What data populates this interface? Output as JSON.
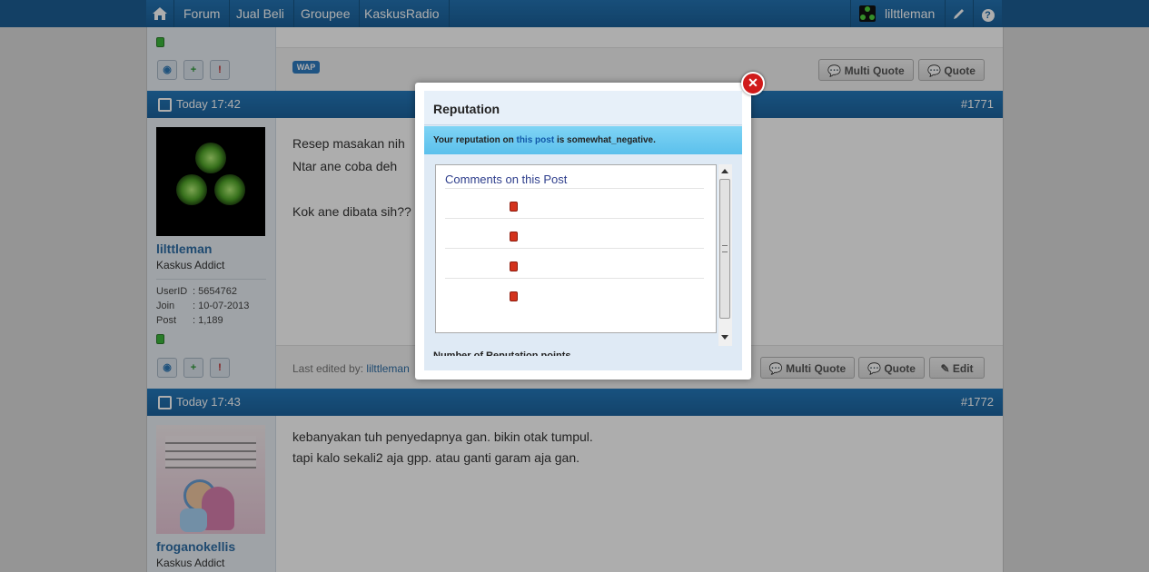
{
  "nav": {
    "items": [
      "Forum",
      "Jual Beli",
      "Groupee",
      "KaskusRadio"
    ],
    "username": "lilttleman"
  },
  "post_prev": {
    "wap_label": "WAP",
    "buttons": {
      "multi_quote": "Multi Quote",
      "quote": "Quote"
    }
  },
  "post_1771": {
    "time": "Today 17:42",
    "number": "#1771",
    "username": "lilttleman",
    "rank": "Kaskus Addict",
    "info": [
      {
        "label": "UserID",
        "value": ": 5654762"
      },
      {
        "label": "Join",
        "value": ": 10-07-2013"
      },
      {
        "label": "Post",
        "value": ": 1,189"
      }
    ],
    "lines": [
      "Resep masakan nih",
      "Ntar ane coba deh",
      "",
      "Kok ane dibata sih??"
    ],
    "last_edited_prefix": "Last edited by:",
    "last_edited_user": "lilttleman",
    "buttons": {
      "multi_quote": "Multi Quote",
      "quote": "Quote",
      "edit": "Edit"
    }
  },
  "post_1772": {
    "time": "Today 17:43",
    "number": "#1772",
    "username": "froganokellis",
    "rank": "Kaskus Addict",
    "lines": [
      "kebanyakan tuh penyedapnya gan. bikin otak tumpul.",
      "tapi kalo sekali2 aja gpp. atau ganti garam aja gan."
    ]
  },
  "modal": {
    "title": "Reputation",
    "rep_prefix": "Your reputation on",
    "rep_link": "this post",
    "rep_suffix": "is somewhat_negative.",
    "comments_title": "Comments on this Post",
    "cutoff_text": "Number of Reputation points"
  },
  "colors": {
    "header_blue": "#1d6aa8",
    "negative_rep": "#d3321c",
    "positive_rep": "#3cb73c"
  }
}
